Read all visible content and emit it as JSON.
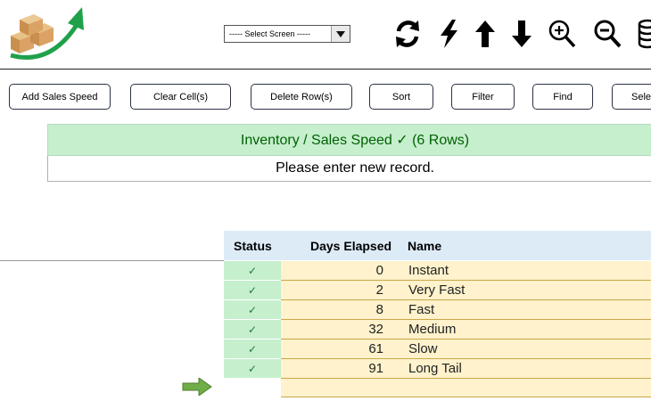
{
  "header": {
    "screen_select": {
      "value": "----- Select Screen -----"
    },
    "toolbar_icons": [
      "refresh-icon",
      "lightning-icon",
      "arrow-up-icon",
      "arrow-down-icon",
      "zoom-in-icon",
      "zoom-out-icon",
      "database-icon"
    ]
  },
  "actions": [
    {
      "label": "Add Sales Speed"
    },
    {
      "label": "Clear Cell(s)"
    },
    {
      "label": "Delete Row(s)"
    },
    {
      "label": "Sort"
    },
    {
      "label": "Filter"
    },
    {
      "label": "Find"
    },
    {
      "label": "Sele"
    }
  ],
  "banner": {
    "title": "Inventory / Sales Speed ✓ (6 Rows)"
  },
  "message": "Please enter new record.",
  "table": {
    "columns": [
      "Status",
      "Days Elapsed",
      "Name"
    ],
    "rows": [
      {
        "status": "✓",
        "days": "0",
        "name": "Instant"
      },
      {
        "status": "✓",
        "days": "2",
        "name": "Very Fast"
      },
      {
        "status": "✓",
        "days": "8",
        "name": "Fast"
      },
      {
        "status": "✓",
        "days": "32",
        "name": "Medium"
      },
      {
        "status": "✓",
        "days": "61",
        "name": "Slow"
      },
      {
        "status": "✓",
        "days": "91",
        "name": "Long Tail"
      }
    ]
  },
  "colors": {
    "banner_bg": "#c6efce",
    "banner_text": "#006100",
    "header_bg": "#ddebf7",
    "cell_bg": "#fff2cc",
    "pointer": "#70ad47"
  }
}
